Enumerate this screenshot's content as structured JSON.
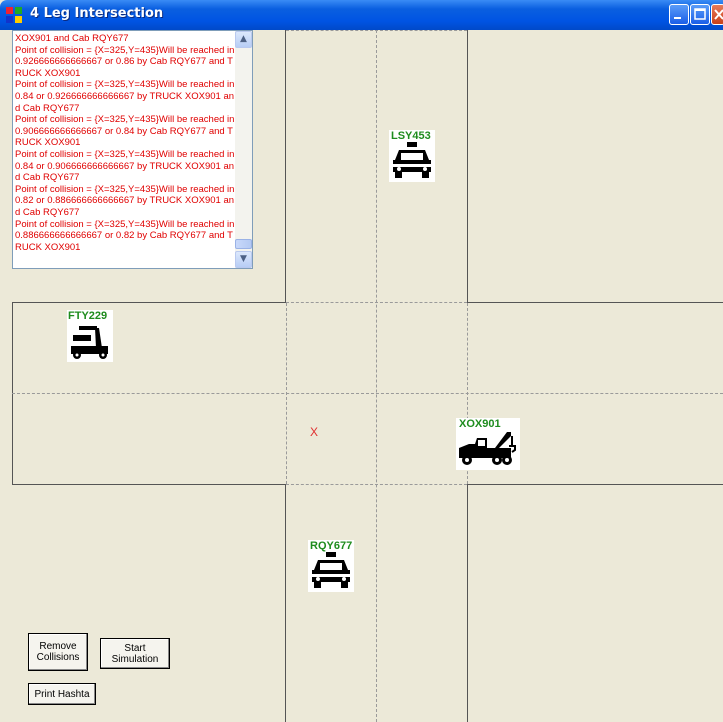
{
  "window": {
    "title": "4 Leg Intersection"
  },
  "log": {
    "text": "XOX901 and Cab RQY677\nPoint of collision = {X=325,Y=435}Will be reached in 0.926666666666667 or 0.86 by Cab RQY677 and TRUCK XOX901\nPoint of collision = {X=325,Y=435}Will be reached in 0.84 or 0.926666666666667 by TRUCK XOX901 and Cab RQY677\nPoint of collision = {X=325,Y=435}Will be reached in 0.906666666666667 or 0.84 by Cab RQY677 and TRUCK XOX901\nPoint of collision = {X=325,Y=435}Will be reached in 0.84 or 0.906666666666667 by TRUCK XOX901 and Cab RQY677\nPoint of collision = {X=325,Y=435}Will be reached in 0.82 or 0.886666666666667 by TRUCK XOX901 and Cab RQY677\nPoint of collision = {X=325,Y=435}Will be reached in 0.886666666666667 or 0.82 by Cab RQY677 and TRUCK XOX901"
  },
  "vehicles": {
    "north": {
      "label": "LSY453",
      "icon": "taxi-icon"
    },
    "west": {
      "label": "FTY229",
      "icon": "scooter-icon"
    },
    "east": {
      "label": "XOX901",
      "icon": "tow-truck-icon"
    },
    "south": {
      "label": "RQY677",
      "icon": "taxi-icon"
    }
  },
  "collision_marker": "X",
  "buttons": {
    "remove": "Remove\nCollisions",
    "start": "Start\nSimulation",
    "print": "Print Hashta"
  },
  "colors": {
    "log_text": "#e00000",
    "vehicle_label": "#1e8c1e",
    "marker": "#e03030"
  }
}
